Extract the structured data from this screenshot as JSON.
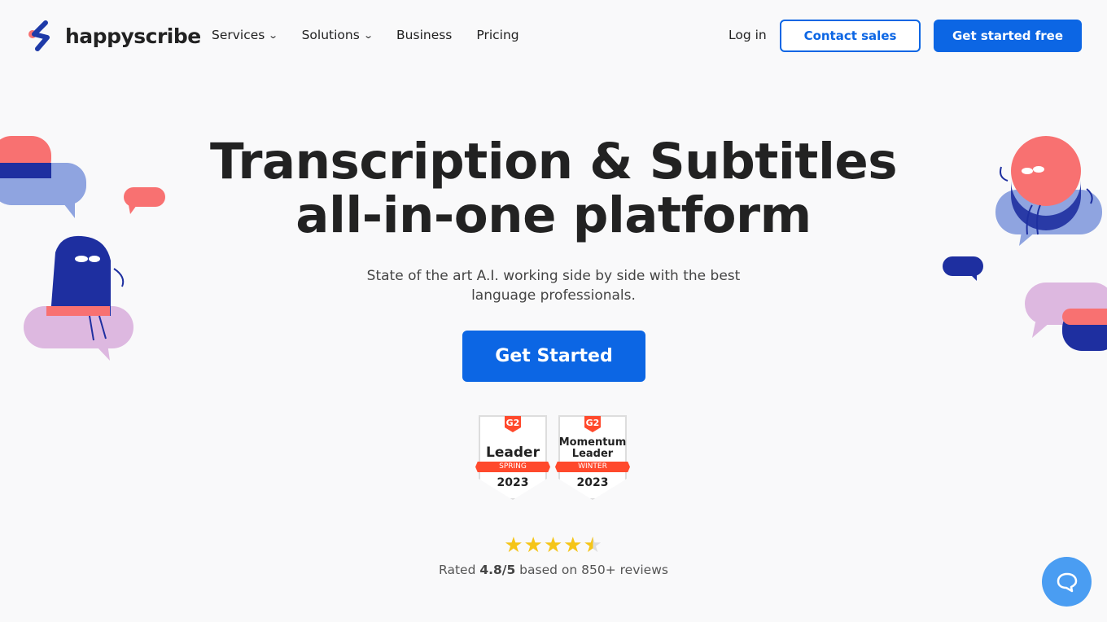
{
  "nav": {
    "brand": "happyscribe",
    "menu": [
      {
        "label": "Services",
        "dropdown": true
      },
      {
        "label": "Solutions",
        "dropdown": true
      },
      {
        "label": "Business",
        "dropdown": false
      },
      {
        "label": "Pricing",
        "dropdown": false
      }
    ],
    "login": "Log in",
    "contact": "Contact sales",
    "get_started": "Get started free"
  },
  "hero": {
    "title_line1": "Transcription & Subtitles",
    "title_line2": "all-in-one platform",
    "subtitle_line1": "State of the art A.I. working side by side with the best",
    "subtitle_line2": "language professionals.",
    "cta": "Get Started"
  },
  "badges": [
    {
      "logo": "G2",
      "title_line1": "",
      "title_line2": "Leader",
      "season": "SPRING",
      "year": "2023"
    },
    {
      "logo": "G2",
      "title_line1": "Momentum",
      "title_line2": "Leader",
      "season": "WINTER",
      "year": "2023"
    }
  ],
  "rating": {
    "stars": 4.8,
    "max": 5,
    "prefix": "Rated ",
    "score": "4.8/5",
    "suffix": " based on 850+ reviews"
  },
  "colors": {
    "primary": "#0c66e4",
    "star": "#f5c518",
    "g2": "#ff492c"
  },
  "chat": {
    "icon": "chat-bubble-icon"
  }
}
